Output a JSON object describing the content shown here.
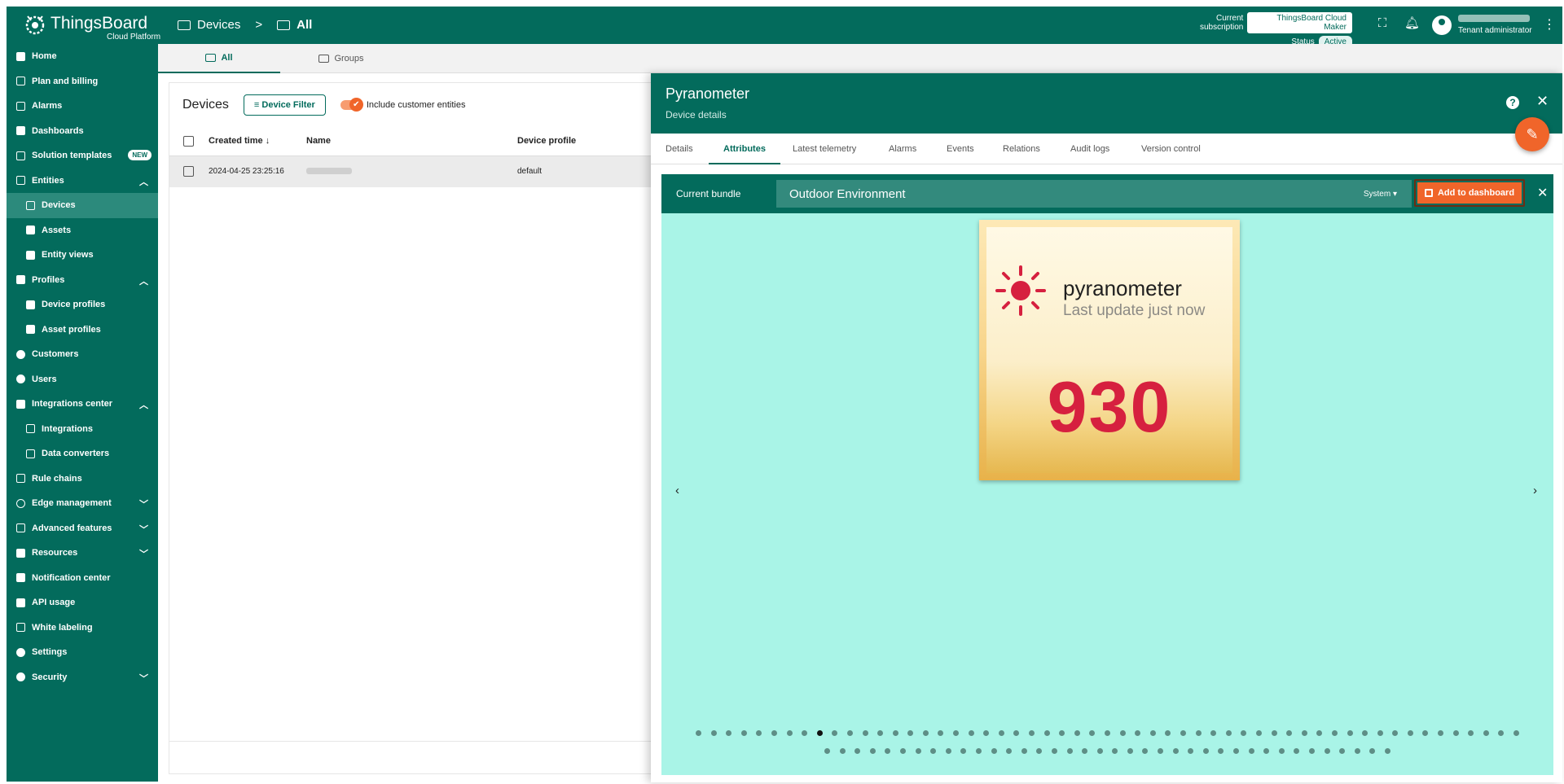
{
  "brand": {
    "name": "ThingsBoard",
    "sub": "Cloud Platform"
  },
  "breadcrumb": {
    "root": "Devices",
    "current": "All",
    "separator": ">"
  },
  "subscription": {
    "label": "Current subscription",
    "plan": "ThingsBoard Cloud Maker",
    "status_label": "Status",
    "status": "Active"
  },
  "user": {
    "role": "Tenant administrator"
  },
  "sidebar": {
    "items": [
      {
        "label": "Home"
      },
      {
        "label": "Plan and billing"
      },
      {
        "label": "Alarms"
      },
      {
        "label": "Dashboards"
      },
      {
        "label": "Solution templates",
        "badge": "NEW"
      },
      {
        "label": "Entities"
      },
      {
        "label": "Devices"
      },
      {
        "label": "Assets"
      },
      {
        "label": "Entity views"
      },
      {
        "label": "Profiles"
      },
      {
        "label": "Device profiles"
      },
      {
        "label": "Asset profiles"
      },
      {
        "label": "Customers"
      },
      {
        "label": "Users"
      },
      {
        "label": "Integrations center"
      },
      {
        "label": "Integrations"
      },
      {
        "label": "Data converters"
      },
      {
        "label": "Rule chains"
      },
      {
        "label": "Edge management"
      },
      {
        "label": "Advanced features"
      },
      {
        "label": "Resources"
      },
      {
        "label": "Notification center"
      },
      {
        "label": "API usage"
      },
      {
        "label": "White labeling"
      },
      {
        "label": "Settings"
      },
      {
        "label": "Security"
      }
    ]
  },
  "main_tabs": [
    {
      "label": "All"
    },
    {
      "label": "Groups"
    }
  ],
  "devices": {
    "title": "Devices",
    "filter": "Device Filter",
    "include_customers": "Include customer entities",
    "columns": [
      "Created time",
      "Name",
      "Device profile"
    ],
    "rows": [
      {
        "created": "2024-04-25 23:25:16",
        "profile": "default"
      }
    ]
  },
  "panel": {
    "title": "Pyranometer",
    "subtitle": "Device details",
    "help": "?",
    "tabs": [
      "Details",
      "Attributes",
      "Latest telemetry",
      "Alarms",
      "Events",
      "Relations",
      "Audit logs",
      "Version control"
    ],
    "bundle_label": "Current bundle",
    "bundle_name": "Outdoor Environment",
    "bundle_scope": "System",
    "add_button": "Add to dashboard"
  },
  "widget_preview": {
    "name": "pyranometer",
    "update": "Last update just now",
    "value": "930",
    "value_color": "#d6203f"
  },
  "colors": {
    "primary": "#036b5c",
    "accent": "#f0652a",
    "preview_bg": "#a9f4e7"
  },
  "pagination": {
    "row1_dots": 55,
    "row2_dots": 38,
    "active_index": 8
  }
}
